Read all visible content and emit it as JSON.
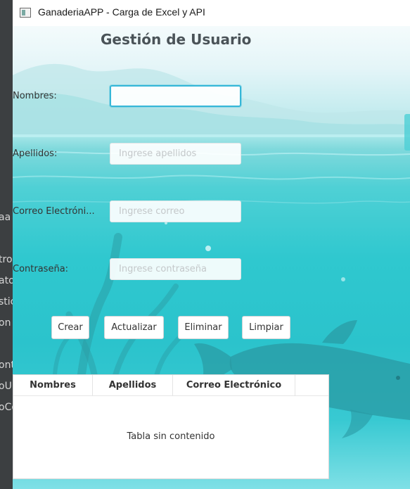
{
  "window": {
    "title": "GanaderiaAPP - Carga de Excel y API"
  },
  "form": {
    "heading": "Gestión de Usuario",
    "nombres": {
      "label": "Nombres:",
      "value": "",
      "placeholder": ""
    },
    "apellidos": {
      "label": "Apellidos:",
      "value": "",
      "placeholder": "Ingrese apellidos"
    },
    "correo": {
      "label": "Correo Electróni...",
      "value": "",
      "placeholder": "Ingrese correo"
    },
    "contrasena": {
      "label": "Contraseña:",
      "value": "",
      "placeholder": "Ingrese contraseña"
    }
  },
  "buttons": {
    "crear": "Crear",
    "actualizar": "Actualizar",
    "eliminar": "Eliminar",
    "limpiar": "Limpiar"
  },
  "table": {
    "columns": [
      "Nombres",
      "Apellidos",
      "Correo Electrónico"
    ],
    "empty_text": "Tabla sin contenido"
  },
  "background_fragments": [
    "aa",
    "tro",
    "ato",
    "stic",
    "on",
    "ont",
    "oU",
    "oCo"
  ],
  "colors": {
    "focus_border": "#36b7d8",
    "water": "#2fc8cf",
    "heading": "#4a5358"
  }
}
